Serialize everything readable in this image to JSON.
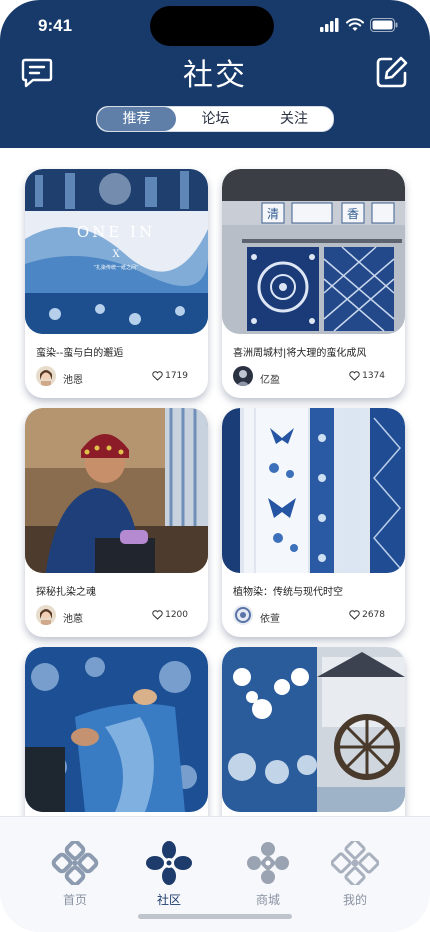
{
  "status": {
    "time": "9:41"
  },
  "header": {
    "title": "社交"
  },
  "tabs": [
    {
      "label": "推荐",
      "active": true
    },
    {
      "label": "论坛",
      "active": false
    },
    {
      "label": "关注",
      "active": false
    }
  ],
  "posts": [
    {
      "title": "蛮染--蛮与白的邂逅",
      "author": "池恩",
      "likes": "1719",
      "image_text": {
        "line1": "ONE IN",
        "line2": "X",
        "line3": "“扎染传统一纸之间”"
      }
    },
    {
      "title": "喜洲周城村|将大理的蛮化成风",
      "author": "亿盈",
      "likes": "1374",
      "image_text": {
        "line1": "清",
        "line2": "香"
      }
    },
    {
      "title": "探秘扎染之魂",
      "author": "池蒽",
      "likes": "1200"
    },
    {
      "title": "植物染：传统与现代时空",
      "author": "依萱",
      "likes": "2678"
    },
    {
      "title": "",
      "author": "",
      "likes": ""
    },
    {
      "title": "",
      "author": "",
      "likes": ""
    }
  ],
  "bottom_nav": [
    {
      "label": "首页",
      "active": false
    },
    {
      "label": "社区",
      "active": true
    },
    {
      "label": "商城",
      "active": false
    },
    {
      "label": "我的",
      "active": false
    }
  ],
  "colors": {
    "primary": "#173a6a",
    "segment_active": "#5f7fa9",
    "indigo": "#1e4f8f"
  }
}
